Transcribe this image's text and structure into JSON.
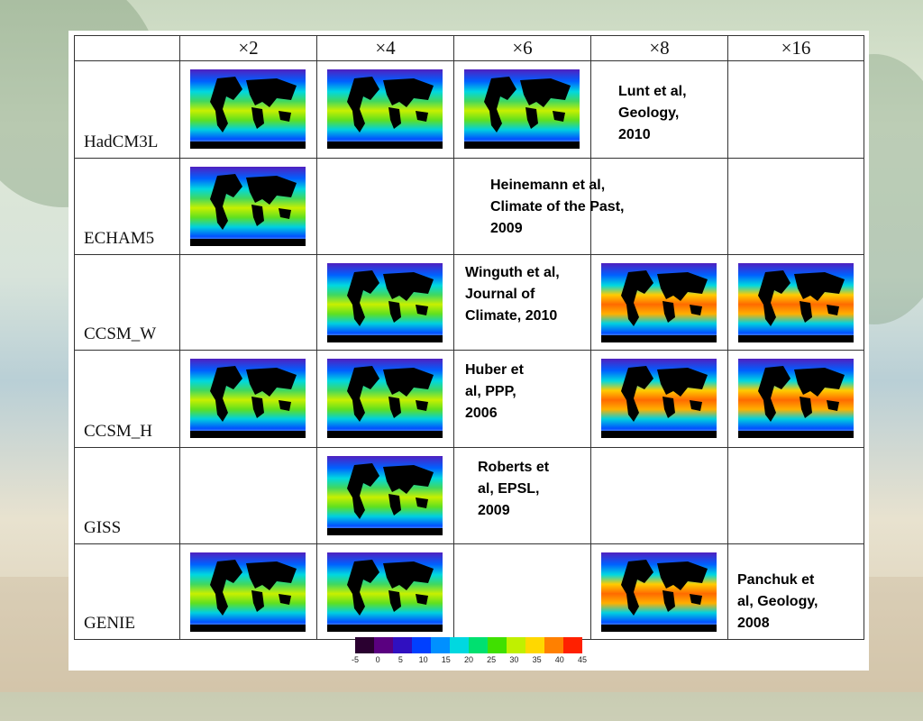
{
  "columns": [
    "×2",
    "×4",
    "×6",
    "×8",
    "×16"
  ],
  "rows": [
    {
      "model": "HadCM3L",
      "maps": [
        1,
        1,
        1,
        0,
        0
      ]
    },
    {
      "model": "ECHAM5",
      "maps": [
        1,
        0,
        0,
        0,
        0
      ]
    },
    {
      "model": "CCSM_W",
      "maps": [
        0,
        1,
        0,
        1,
        1
      ]
    },
    {
      "model": "CCSM_H",
      "maps": [
        1,
        1,
        0,
        1,
        1
      ]
    },
    {
      "model": "GISS",
      "maps": [
        0,
        1,
        0,
        0,
        0
      ]
    },
    {
      "model": "GENIE",
      "maps": [
        1,
        1,
        0,
        1,
        0
      ]
    }
  ],
  "citations": [
    {
      "lines": [
        "Lunt et al,",
        "Geology,",
        "2010"
      ]
    },
    {
      "lines": [
        "Heinemann et al,",
        "Climate of the Past,",
        "2009"
      ]
    },
    {
      "lines": [
        "Winguth et al,",
        "Journal of",
        "Climate, 2010"
      ]
    },
    {
      "lines": [
        "Huber et",
        "al, PPP,",
        "2006"
      ]
    },
    {
      "lines": [
        "Roberts et",
        "al, EPSL,",
        "2009"
      ]
    },
    {
      "lines": [
        "Panchuk et",
        "al, Geology,",
        "2008"
      ]
    }
  ],
  "colorbar": {
    "ticks": [
      "-5",
      "0",
      "5",
      "10",
      "15",
      "20",
      "25",
      "30",
      "35",
      "40",
      "45"
    ],
    "colors": [
      "#2a0030",
      "#5a0080",
      "#3010c0",
      "#0040ff",
      "#0090ff",
      "#00d8e0",
      "#00e070",
      "#40e000",
      "#c0f000",
      "#ffd800",
      "#ff8000",
      "#ff2000"
    ]
  }
}
